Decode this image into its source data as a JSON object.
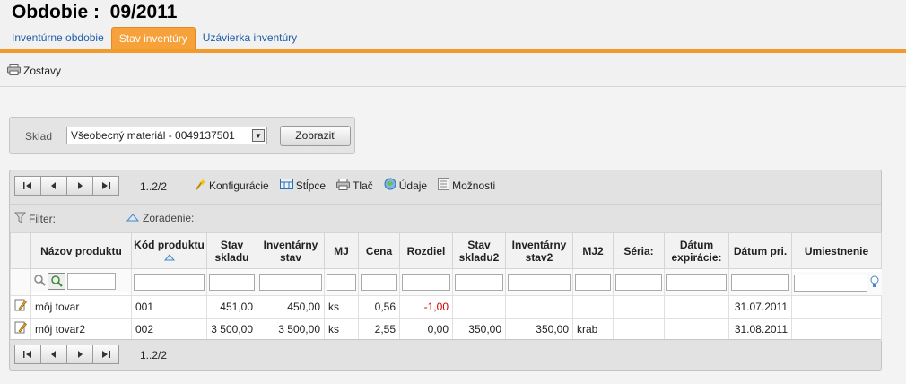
{
  "header": {
    "title": "Obdobie :  09/2011",
    "tabs": [
      {
        "label": "Inventúrne obdobie",
        "active": false
      },
      {
        "label": "Stav inventúry",
        "active": true
      },
      {
        "label": "Uzávierka inventúry",
        "active": false
      }
    ]
  },
  "toolbar": {
    "reports_label": "Zostavy",
    "icon": "printer-icon"
  },
  "filter_panel": {
    "store_label": "Sklad",
    "store_value": "Všeobecný materiál - 0049137501",
    "show_button": "Zobraziť"
  },
  "grid": {
    "page_info": "1..2/2",
    "tools": [
      {
        "label": "Konfigurácie",
        "icon": "wand-icon"
      },
      {
        "label": "Stĺpce",
        "icon": "columns-icon"
      },
      {
        "label": "Tlač",
        "icon": "printer-icon"
      },
      {
        "label": "Údaje",
        "icon": "data-globe-icon"
      },
      {
        "label": "Možnosti",
        "icon": "options-icon"
      }
    ],
    "filter_label": "Filter:",
    "sort_label": "Zoradenie:",
    "columns": [
      "Názov produktu",
      "Kód produktu",
      "Stav skladu",
      "Inventárny stav",
      "MJ",
      "Cena",
      "Rozdiel",
      "Stav skladu2",
      "Inventárny stav2",
      "MJ2",
      "Séria:",
      "Dátum expirácie:",
      "Dátum pri.",
      "Umiestnenie"
    ],
    "rows": [
      [
        "môj tovar",
        "001",
        "451,00",
        "450,00",
        "ks",
        "0,56",
        "-1,00",
        "",
        "",
        "",
        "",
        "",
        "31.07.2011",
        ""
      ],
      [
        "môj tovar2",
        "002",
        "3 500,00",
        "3 500,00",
        "ks",
        "2,55",
        "0,00",
        "350,00",
        "350,00",
        "krab",
        "",
        "",
        "31.08.2011",
        ""
      ]
    ],
    "colors": {
      "accent": "#f39a2c",
      "link": "#1f5ea8",
      "negative": "#d00000"
    }
  }
}
